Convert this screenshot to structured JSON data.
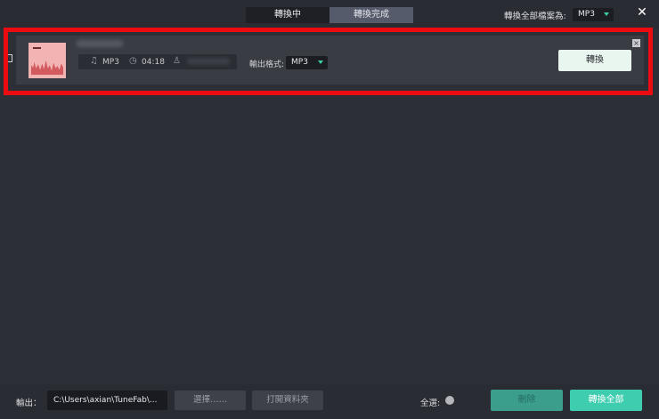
{
  "header": {
    "tabs": [
      {
        "label": "轉換中",
        "active": true
      },
      {
        "label": "轉換完成",
        "active": false
      }
    ],
    "convert_all_label": "轉換全部檔案為:",
    "convert_all_format": "MP3",
    "close_icon": "close-icon"
  },
  "song": {
    "format": "MP3",
    "duration": "04:18",
    "output_format_label": "輸出格式:",
    "output_format": "MP3",
    "convert_label": "轉換",
    "icons": {
      "format": "music-note-icon",
      "duration": "clock-icon",
      "artist": "person-icon"
    }
  },
  "footer": {
    "output_label": "輸出：",
    "output_path": "C:\\Users\\axian\\TuneFab\\...",
    "choose_label": "選擇……",
    "open_folder_label": "打開資料夾",
    "select_all_label": "全選:",
    "delete_label": "刪除",
    "convert_all_label": "轉換全部"
  },
  "colors": {
    "accent": "#3fcdb0",
    "highlight_border": "#ec0b10",
    "background": "#2d2f37"
  }
}
